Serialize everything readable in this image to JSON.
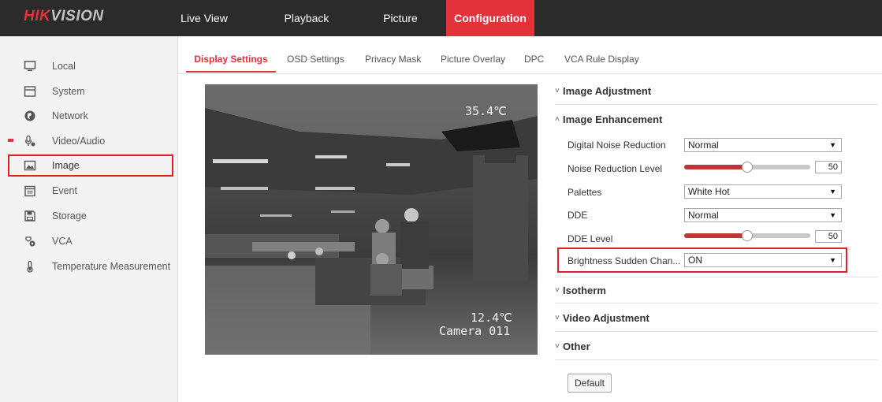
{
  "brand": {
    "part1": "HIK",
    "part2": "VISION"
  },
  "nav": {
    "live_view": "Live View",
    "playback": "Playback",
    "picture": "Picture",
    "configuration": "Configuration"
  },
  "sidebar": {
    "items": [
      {
        "label": "Local",
        "icon": "monitor-icon"
      },
      {
        "label": "System",
        "icon": "system-icon"
      },
      {
        "label": "Network",
        "icon": "globe-icon"
      },
      {
        "label": "Video/Audio",
        "icon": "microphone-icon"
      },
      {
        "label": "Image",
        "icon": "image-icon",
        "active": true
      },
      {
        "label": "Event",
        "icon": "calendar-icon"
      },
      {
        "label": "Storage",
        "icon": "floppy-icon"
      },
      {
        "label": "VCA",
        "icon": "vca-icon"
      },
      {
        "label": "Temperature Measurement",
        "icon": "thermometer-icon"
      }
    ]
  },
  "subtabs": [
    {
      "label": "Display Settings",
      "active": true
    },
    {
      "label": "OSD Settings"
    },
    {
      "label": "Privacy Mask"
    },
    {
      "label": "Picture Overlay"
    },
    {
      "label": "DPC"
    },
    {
      "label": "VCA Rule Display"
    }
  ],
  "video": {
    "max_temp": "35.4℃",
    "min_temp": "12.4℃",
    "camera_name": "Camera 011"
  },
  "sections": {
    "image_adjustment": "Image Adjustment",
    "image_enhancement": "Image Enhancement",
    "isotherm": "Isotherm",
    "video_adjustment": "Video Adjustment",
    "other": "Other"
  },
  "fields": {
    "digital_noise_reduction": {
      "label": "Digital Noise Reduction",
      "value": "Normal"
    },
    "noise_reduction_level": {
      "label": "Noise Reduction Level",
      "value": "50",
      "fraction": 0.5
    },
    "palettes": {
      "label": "Palettes",
      "value": "White Hot"
    },
    "dde": {
      "label": "DDE",
      "value": "Normal"
    },
    "dde_level": {
      "label": "DDE Level",
      "value": "50",
      "fraction": 0.5
    },
    "brightness_sudden_change": {
      "label": "Brightness Sudden Chan...",
      "value": "ON"
    }
  },
  "buttons": {
    "default": "Default"
  },
  "colors": {
    "accent": "#e4323b",
    "topbar": "#2b2b2b",
    "highlight": "#e02020"
  }
}
